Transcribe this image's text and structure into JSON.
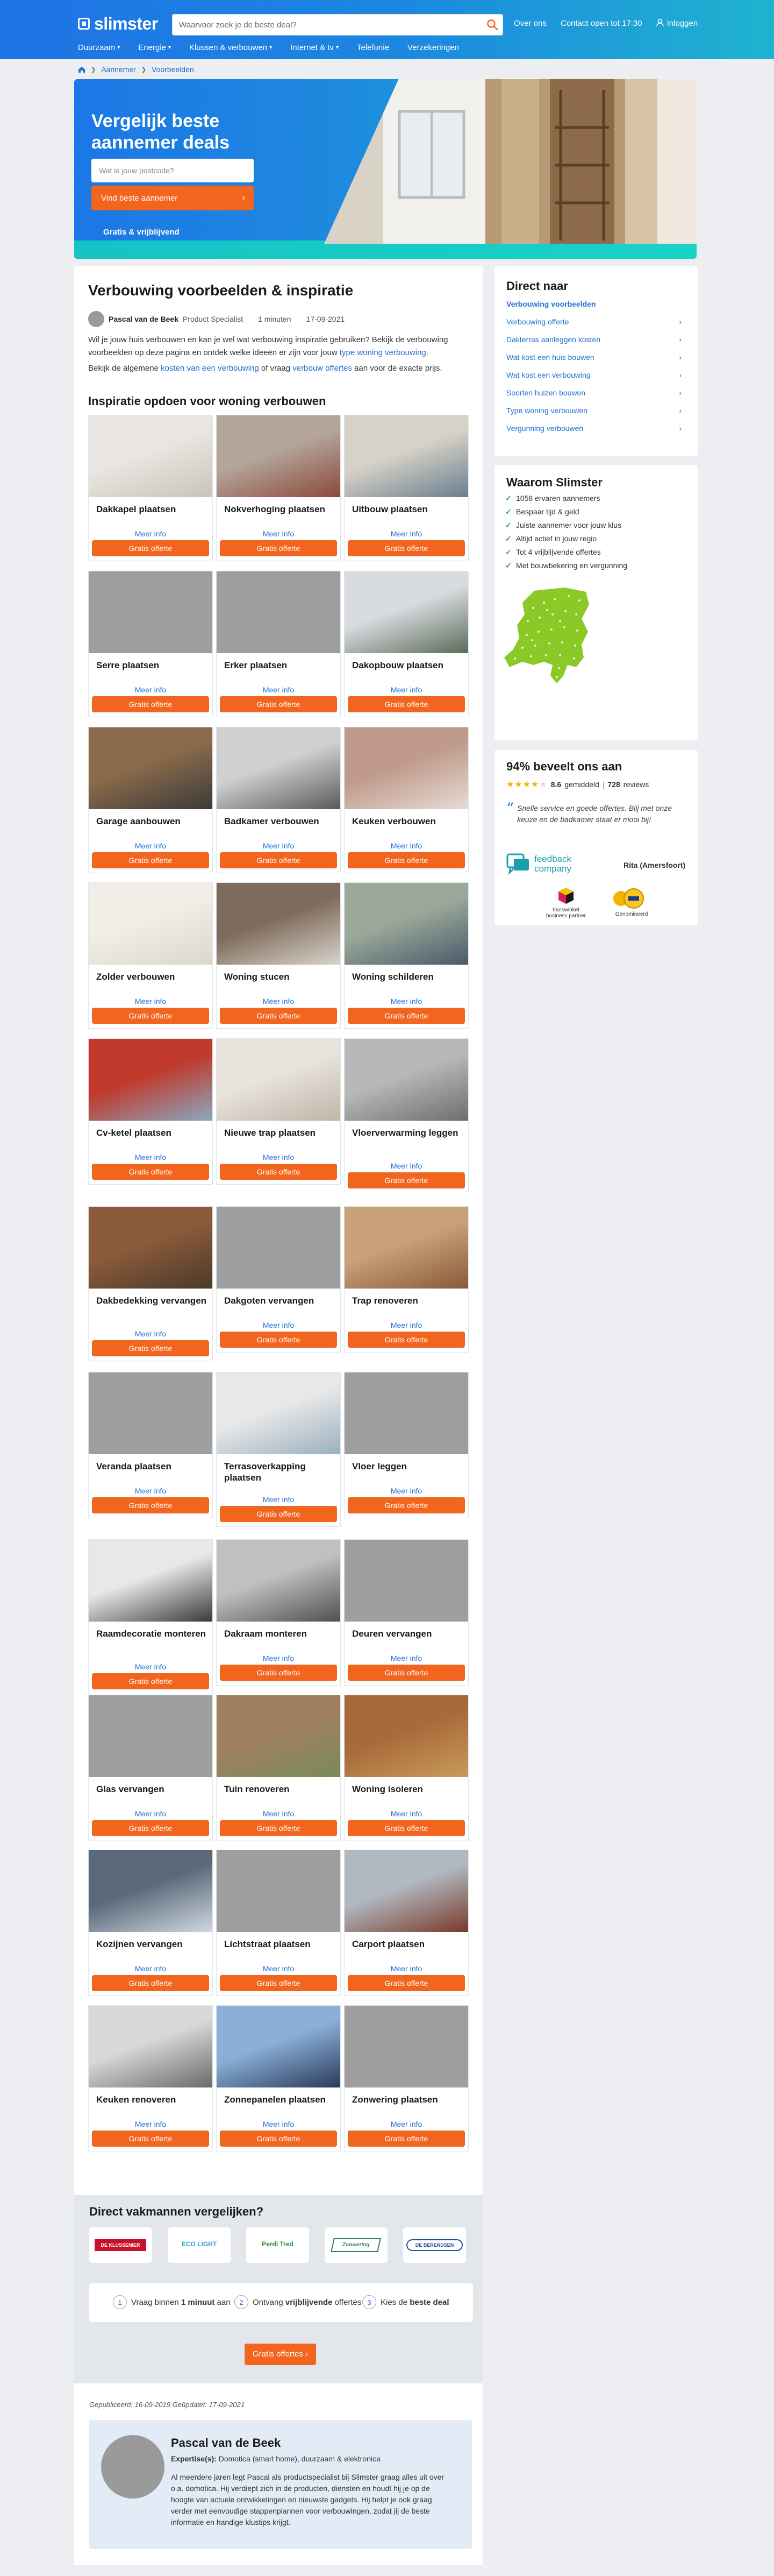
{
  "header": {
    "logo": "slimster",
    "search_placeholder": "Waarvoor zoek je de beste deal?",
    "links": [
      "Over ons",
      "Contact open tot 17:30",
      "Inloggen"
    ],
    "nav": [
      "Duurzaam",
      "Energie",
      "Klussen & verbouwen",
      "Internet & tv",
      "Telefonie",
      "Verzekeringen"
    ]
  },
  "breadcrumb": [
    "Aannemer",
    "Voorbeelden"
  ],
  "hero": {
    "title": "Vergelijk beste aannemer deals",
    "postcode_placeholder": "Wat is jouw postcode?",
    "cta": "Vind beste aannemer",
    "free": "Gratis & vrijblijvend"
  },
  "article": {
    "title": "Verbouwing voorbeelden & inspiratie",
    "author_name": "Pascal van de Beek",
    "author_role": "Product Specialist",
    "read_time": "1 minuten",
    "date": "17-09-2021",
    "intro1_pre": "Wil je jouw huis verbouwen en kan je wel wat verbouwing inspiratie gebruiken? Bekijk de verbouwing voorbeelden op deze pagina en ontdek welke ideeën er zijn voor jouw ",
    "intro1_link": "type woning verbouwing",
    "intro1_post": ".",
    "intro2_pre": "Bekijk de algemene ",
    "intro2_link1": "kosten van een verbouwing",
    "intro2_mid": " of vraag ",
    "intro2_link2": "verbouw offertes",
    "intro2_post": " aan voor de exacte prijs.",
    "inspiration_title": "Inspiratie opdoen voor woning verbouwen",
    "more_label": "Meer info",
    "quote_label": "Gratis offerte"
  },
  "tiles": [
    "Dakkapel plaatsen",
    "Nokverhoging plaatsen",
    "Uitbouw plaatsen",
    "Serre plaatsen",
    "Erker plaatsen",
    "Dakopbouw plaatsen",
    "Garage aanbouwen",
    "Badkamer verbouwen",
    "Keuken verbouwen",
    "Zolder verbouwen",
    "Woning stucen",
    "Woning schilderen",
    "Cv-ketel plaatsen",
    "Nieuwe trap plaatsen",
    "Vloerverwarming leggen",
    "Dakbedekking vervangen",
    "Dakgoten vervangen",
    "Trap renoveren",
    "Veranda plaatsen",
    "Terrasoverkapping plaatsen",
    "Vloer leggen",
    "Raamdecoratie monteren",
    "Dakraam monteren",
    "Deuren vervangen",
    "Glas vervangen",
    "Tuin renoveren",
    "Woning isoleren",
    "Kozijnen vervangen",
    "Lichtstraat plaatsen",
    "Carport plaatsen",
    "Keuken renoveren",
    "Zonnepanelen plaatsen",
    "Zonwering plaatsen"
  ],
  "direct": {
    "title": "Direct naar",
    "items": [
      "Verbouwing voorbeelden",
      "Verbouwing offerte",
      "Dakterras aanleggen kosten",
      "Wat kost een huis bouwen",
      "Wat kost een verbouwing",
      "Soorten huizen bouwen",
      "Type woning verbouwen",
      "Vergunning verbouwen"
    ]
  },
  "waarom": {
    "title": "Waarom Slimster",
    "items": [
      "1058 ervaren aannemers",
      "Bespaar tijd & geld",
      "Juiste aannemer voor jouw klus",
      "Altijd actief in jouw regio",
      "Tot 4 vrijblijvende offertes",
      "Met bouwbekering en vergunning"
    ]
  },
  "reviews": {
    "title": "94% beveelt ons aan",
    "rating_value": "8.6",
    "rating_suffix": "gemiddeld",
    "count_value": "728",
    "count_suffix": "reviews",
    "quote": "Snelle service en goede offertes. Blij met onze keuze en de badkamer staat er mooi bij!",
    "feedback_brand": "feedback company",
    "reviewer": "Rita (Amersfoort)",
    "badge1": "thuiswinkel business partner",
    "badge2": "Genomineerd"
  },
  "vakmannen": {
    "title": "Direct vakmannen vergelijken?",
    "partners": [
      "DE KLUSSENIER",
      "ECO LIGHT",
      "Perdi Tred",
      "Zonwering",
      "DE BERENDSEN"
    ],
    "step1": [
      "Vraag binnen ",
      "1 minuut",
      " aan"
    ],
    "step2": [
      "Ontvang ",
      "vrijblijvende",
      " offertes"
    ],
    "step3": [
      "Kies de ",
      "beste deal"
    ],
    "cta": "Gratis offertes"
  },
  "footer_author": {
    "published": "Gepubliceerd: 16-09-2019 Geüpdatet: 17-09-2021",
    "name": "Pascal van de Beek",
    "expertise_label": "Expertise(s):",
    "expertise": " Domotica (smart home), duurzaam & elektronica",
    "bio": "Al meerdere jaren legt Pascal als productspecialist bij Slimster graag alles uit over o.a. domotica. Hij verdiept zich in de producten, diensten en houdt hij je op de hoogte van actuele ontwikkelingen en nieuwste gadgets. Hij helpt je ook graag verder met eenvoudige stappenplannen voor verbouwingen, zodat jij de beste informatie en handige klustips krijgt."
  },
  "colors": {
    "primary": "#1e73e6",
    "cta": "#f2651f",
    "link": "#1f6fd0",
    "check": "#2aa04a",
    "map": "#8ac926"
  }
}
